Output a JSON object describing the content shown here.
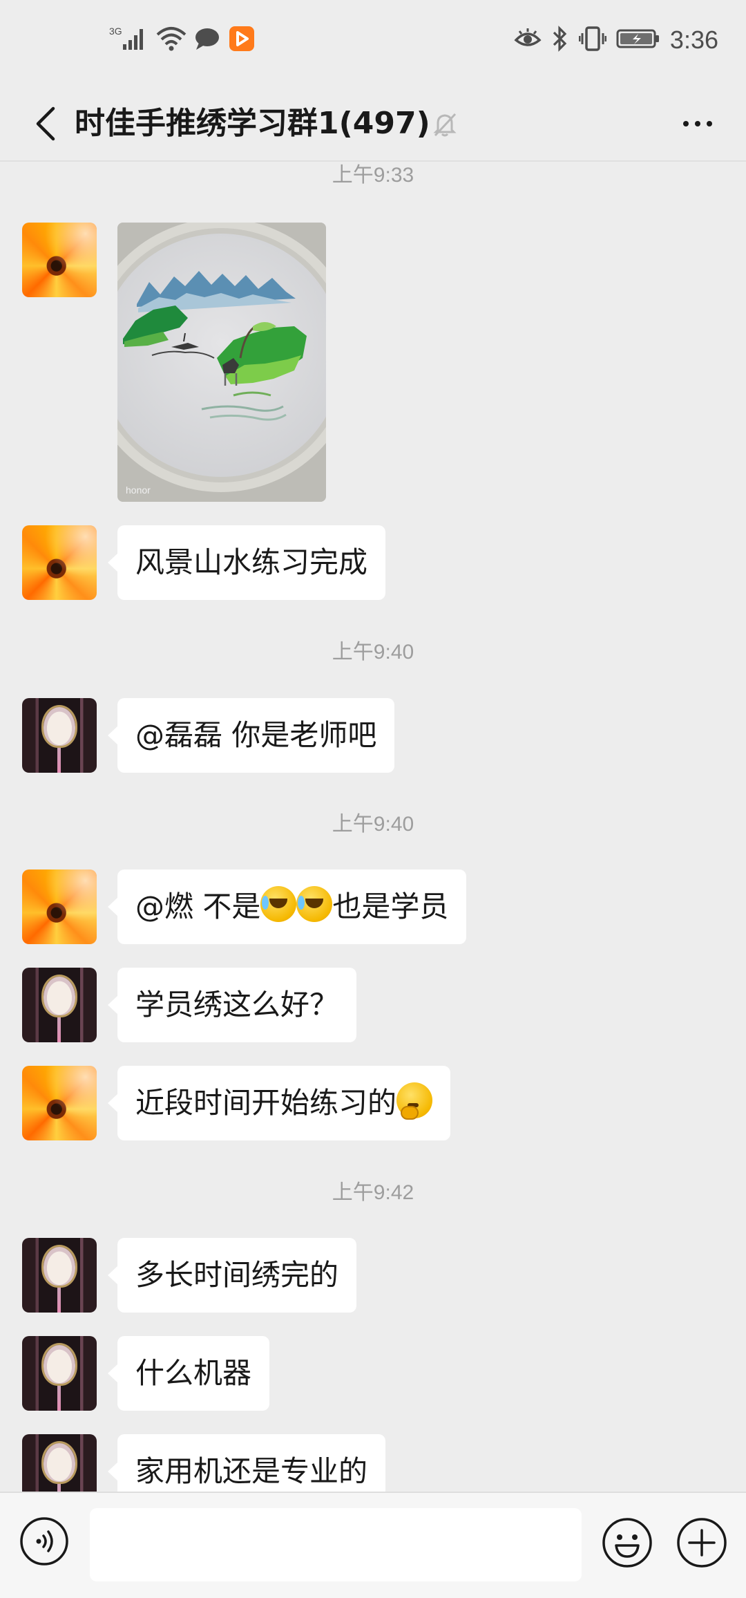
{
  "status_bar": {
    "network": "3G",
    "time": "3:36"
  },
  "header": {
    "title": "时佳手推绣学习群1(497)",
    "icons": [
      "back-icon",
      "mute-bell-icon",
      "more-icon"
    ]
  },
  "chat": {
    "timestamps": [
      "上午9:33",
      "上午9:40",
      "上午9:40",
      "上午9:42"
    ],
    "messages": [
      {
        "sender": "flower",
        "type": "image",
        "watermark": "honor"
      },
      {
        "sender": "flower",
        "type": "text",
        "text": "风景山水练习完成"
      },
      {
        "sender": "fan",
        "type": "text",
        "text": "@磊磊  你是老师吧"
      },
      {
        "sender": "flower",
        "type": "text",
        "part1": "@燃  不是",
        "part2": "也是学员",
        "emoji": [
          "face-with-tears-of-joy",
          "face-with-tears-of-joy"
        ]
      },
      {
        "sender": "fan",
        "type": "text",
        "text": "学员绣这么好？"
      },
      {
        "sender": "flower",
        "type": "text",
        "text": "近段时间开始练习的",
        "emoji": [
          "thinking-face"
        ]
      },
      {
        "sender": "fan",
        "type": "text",
        "text": "多长时间绣完的"
      },
      {
        "sender": "fan",
        "type": "text",
        "text": "什么机器"
      },
      {
        "sender": "fan",
        "type": "text",
        "text": "家用机还是专业的"
      }
    ]
  },
  "input_bar": {
    "value": "",
    "icons": [
      "voice-icon",
      "emoji-icon",
      "plus-icon"
    ]
  },
  "colors": {
    "background": "#ededed",
    "bubble": "#ffffff",
    "timestamp": "#9d9d9d",
    "input_bar": "#f6f6f6"
  }
}
